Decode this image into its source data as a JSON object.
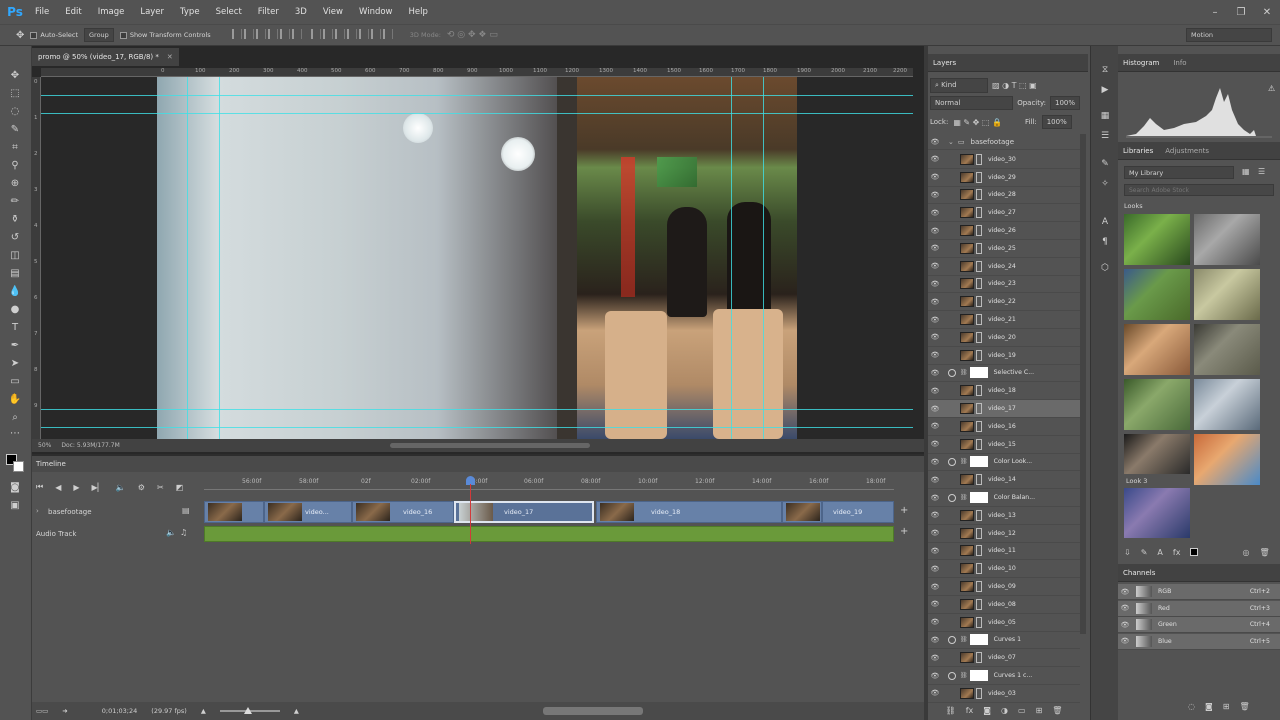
{
  "app": {
    "logo": "Ps"
  },
  "menu": [
    "File",
    "Edit",
    "Image",
    "Layer",
    "Type",
    "Select",
    "Filter",
    "3D",
    "View",
    "Window",
    "Help"
  ],
  "window_controls": [
    "–",
    "❐",
    "✕"
  ],
  "options_bar": {
    "auto_select": "Auto-Select",
    "auto_select_mode": "Group",
    "show_transform": "Show Transform Controls",
    "mode_3d": "3D Mode:",
    "workspace": "Motion"
  },
  "document": {
    "tab_title": "promo @ 50% (video_17, RGB/8) *",
    "zoom": "50%",
    "doc_size": "Doc: 5.93M/177.7M"
  },
  "ruler_h": [
    "0",
    "100",
    "200",
    "300",
    "400",
    "500",
    "600",
    "700",
    "800",
    "900",
    "1000",
    "1100",
    "1200",
    "1300",
    "1400",
    "1500",
    "1600",
    "1700",
    "1800",
    "1900",
    "2000",
    "2100",
    "2200"
  ],
  "ruler_v": [
    "0",
    "1",
    "2",
    "3",
    "4",
    "5",
    "6",
    "7",
    "8",
    "9"
  ],
  "timeline": {
    "title": "Timeline",
    "ruler": [
      "56:00f",
      "58:00f",
      "02f",
      "02:00f",
      "04:00f",
      "06:00f",
      "08:00f",
      "10:00f",
      "12:00f",
      "14:00f",
      "16:00f",
      "18:00f"
    ],
    "tracks": [
      {
        "name": "basefootage"
      },
      {
        "name": "Audio Track"
      }
    ],
    "clips": [
      "",
      "video...",
      "video_16",
      "video_17",
      "video_18",
      "",
      "video_19"
    ],
    "timecode": "0;01;03;24",
    "fps": "(29.97 fps)"
  },
  "layers_panel": {
    "title": "Layers",
    "filter": "Kind",
    "blend_mode": "Normal",
    "opacity_label": "Opacity:",
    "opacity": "100%",
    "lock_label": "Lock:",
    "fill_label": "Fill:",
    "fill": "100%",
    "group": "basefootage",
    "rows": [
      {
        "type": "video",
        "name": "video_30"
      },
      {
        "type": "video",
        "name": "video_29"
      },
      {
        "type": "video",
        "name": "video_28"
      },
      {
        "type": "video",
        "name": "video_27"
      },
      {
        "type": "video",
        "name": "video_26"
      },
      {
        "type": "video",
        "name": "video_25"
      },
      {
        "type": "video",
        "name": "video_24"
      },
      {
        "type": "video",
        "name": "video_23"
      },
      {
        "type": "video",
        "name": "video_22"
      },
      {
        "type": "video",
        "name": "video_21"
      },
      {
        "type": "video",
        "name": "video_20"
      },
      {
        "type": "video",
        "name": "video_19"
      },
      {
        "type": "adj",
        "name": "Selective C..."
      },
      {
        "type": "video",
        "name": "video_18"
      },
      {
        "type": "video",
        "name": "video_17",
        "selected": true
      },
      {
        "type": "video",
        "name": "video_16"
      },
      {
        "type": "video",
        "name": "video_15"
      },
      {
        "type": "adj",
        "name": "Color Look..."
      },
      {
        "type": "video",
        "name": "video_14"
      },
      {
        "type": "adj",
        "name": "Color Balan..."
      },
      {
        "type": "video",
        "name": "video_13"
      },
      {
        "type": "video",
        "name": "video_12"
      },
      {
        "type": "video",
        "name": "video_11"
      },
      {
        "type": "video",
        "name": "video_10"
      },
      {
        "type": "video",
        "name": "video_09"
      },
      {
        "type": "video",
        "name": "video_08"
      },
      {
        "type": "video",
        "name": "video_05"
      },
      {
        "type": "adj",
        "name": "Curves 1"
      },
      {
        "type": "video",
        "name": "video_07"
      },
      {
        "type": "adj",
        "name": "Curves 1 c..."
      },
      {
        "type": "video",
        "name": "video_03"
      }
    ]
  },
  "histogram_panel": {
    "tabs": [
      "Histogram",
      "Info"
    ]
  },
  "libraries_panel": {
    "tabs": [
      "Libraries",
      "Adjustments"
    ],
    "library": "My Library",
    "search_placeholder": "Search Adobe Stock",
    "section": "Looks",
    "selected_look": "Look 3"
  },
  "channels_panel": {
    "title": "Channels",
    "rows": [
      {
        "name": "RGB",
        "shortcut": "Ctrl+2"
      },
      {
        "name": "Red",
        "shortcut": "Ctrl+3"
      },
      {
        "name": "Green",
        "shortcut": "Ctrl+4"
      },
      {
        "name": "Blue",
        "shortcut": "Ctrl+5"
      }
    ]
  },
  "colors": {
    "accent": "#31a8ff",
    "guide": "#3fe0e6",
    "clip": "#6781a8",
    "audio": "#6a9a3a",
    "playhead": "#d23a3a"
  }
}
